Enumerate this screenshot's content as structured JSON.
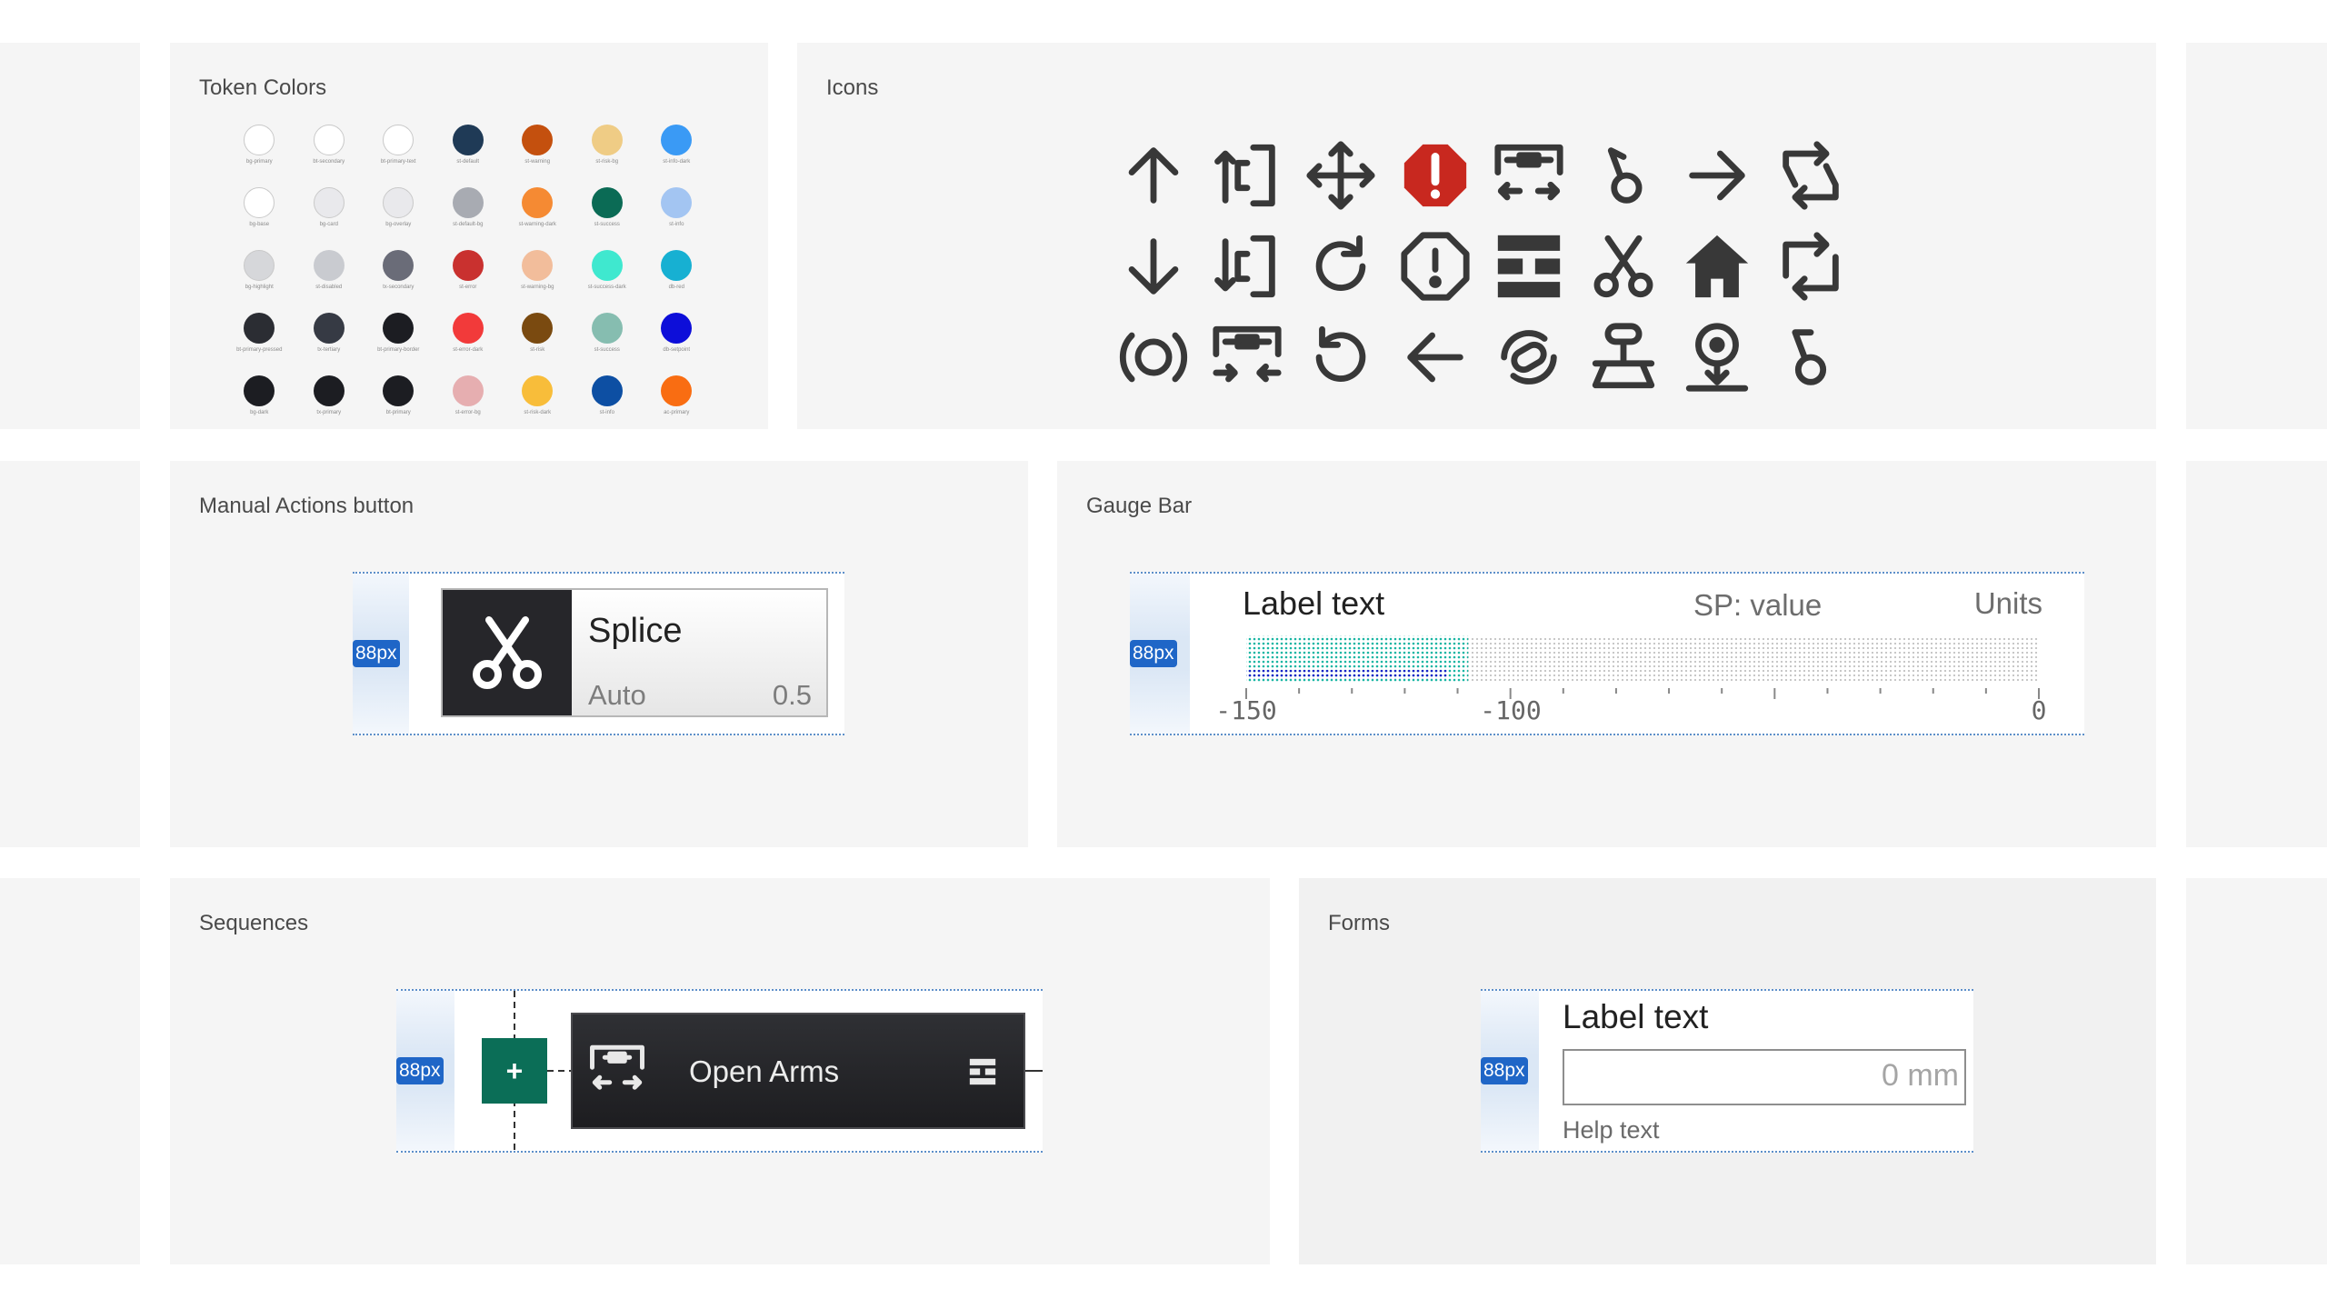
{
  "tokens": {
    "title": "Token Colors",
    "items": [
      {
        "label": "bg-primary",
        "color": "#ffffff",
        "light": true
      },
      {
        "label": "bt-secondary",
        "color": "#ffffff",
        "light": true
      },
      {
        "label": "bt-primary-text",
        "color": "#ffffff",
        "light": true
      },
      {
        "label": "st-default",
        "color": "#1f3a56",
        "light": false
      },
      {
        "label": "st-warning",
        "color": "#c4500e",
        "light": false
      },
      {
        "label": "st-risk-bg",
        "color": "#efcc85",
        "light": false
      },
      {
        "label": "st-info-dark",
        "color": "#3a9af5",
        "light": false
      },
      {
        "label": "bg-base",
        "color": "#ffffff",
        "light": true
      },
      {
        "label": "bg-card",
        "color": "#e9e9ec",
        "light": true
      },
      {
        "label": "bg-overlay",
        "color": "#e9e9ec",
        "light": true
      },
      {
        "label": "st-default-bg",
        "color": "#a8abb2",
        "light": false
      },
      {
        "label": "st-warning-dark",
        "color": "#f58a33",
        "light": false
      },
      {
        "label": "st-success",
        "color": "#0b6b55",
        "light": false
      },
      {
        "label": "st-info",
        "color": "#a3c5f2",
        "light": false
      },
      {
        "label": "bg-highlight",
        "color": "#d6d7da",
        "light": true
      },
      {
        "label": "st-disabled",
        "color": "#c9cbd0",
        "light": false
      },
      {
        "label": "tx-secondary",
        "color": "#6a6c78",
        "light": false
      },
      {
        "label": "st-error",
        "color": "#c9312f",
        "light": false
      },
      {
        "label": "st-warning-bg",
        "color": "#f2bd9b",
        "light": false
      },
      {
        "label": "st-success-dark",
        "color": "#3fe8cf",
        "light": false
      },
      {
        "label": "db-red",
        "color": "#17b0d2",
        "light": false
      },
      {
        "label": "bt-primary-pressed",
        "color": "#2b2d33",
        "light": false
      },
      {
        "label": "tx-tertiary",
        "color": "#363a44",
        "light": false
      },
      {
        "label": "bt-primary-border",
        "color": "#1c1d22",
        "light": false
      },
      {
        "label": "st-error-dark",
        "color": "#f23a3a",
        "light": false
      },
      {
        "label": "st-risk",
        "color": "#7a4a10",
        "light": false
      },
      {
        "label": "st-success",
        "color": "#86bdb0",
        "light": false
      },
      {
        "label": "db-setpoint",
        "color": "#0d0ed9",
        "light": false
      },
      {
        "label": "bg-dark",
        "color": "#1c1d22",
        "light": false
      },
      {
        "label": "tx-primary",
        "color": "#1c1d22",
        "light": false
      },
      {
        "label": "bt-primary",
        "color": "#1c1d22",
        "light": false
      },
      {
        "label": "st-error-bg",
        "color": "#e6aeb0",
        "light": false
      },
      {
        "label": "st-risk-dark",
        "color": "#f8bd3a",
        "light": false
      },
      {
        "label": "st-info",
        "color": "#0d4fa3",
        "light": false
      },
      {
        "label": "ac-primary",
        "color": "#f96d12",
        "light": false
      }
    ]
  },
  "icons": {
    "title": "Icons",
    "items": [
      "arrow-up-icon",
      "gate-up-icon",
      "move-arrows-icon",
      "alert-badge-icon",
      "open-arms-icon",
      "knot-right-icon",
      "arrow-right-icon",
      "loop-arrows-icon",
      "arrow-down-icon",
      "gate-down-icon",
      "rotate-cw-icon",
      "alert-octagon-icon",
      "stack-bars-icon",
      "scissors-icon",
      "home-icon",
      "loop-arrows-alt-icon",
      "signal-ring-icon",
      "close-arms-icon",
      "rotate-ccw-icon",
      "arrow-left-icon",
      "link-rotate-icon",
      "press-icon",
      "drop-target-icon",
      "knot-left-icon"
    ]
  },
  "manual_actions": {
    "title": "Manual Actions button",
    "badge": "88px",
    "button_title": "Splice",
    "mode": "Auto",
    "value": "0.5",
    "icon": "scissors-icon"
  },
  "gauge": {
    "title": "Gauge Bar",
    "badge": "88px",
    "label": "Label text",
    "setpoint": "SP: value",
    "units": "Units",
    "min": -150,
    "max": 0,
    "value": -108,
    "setpoint_value": -112,
    "ticks": [
      "-150",
      "-100",
      "0"
    ],
    "fill_color": "#19b6a3",
    "setpoint_color": "#1b22c8"
  },
  "sequences": {
    "title": "Sequences",
    "badge": "88px",
    "add_label": "+",
    "step_title": "Open Arms",
    "step_icon": "open-arms-icon",
    "menu_icon": "stack-bars-icon"
  },
  "forms": {
    "title": "Forms",
    "badge": "88px",
    "label": "Label text",
    "placeholder": "0 mm",
    "help": "Help text"
  }
}
